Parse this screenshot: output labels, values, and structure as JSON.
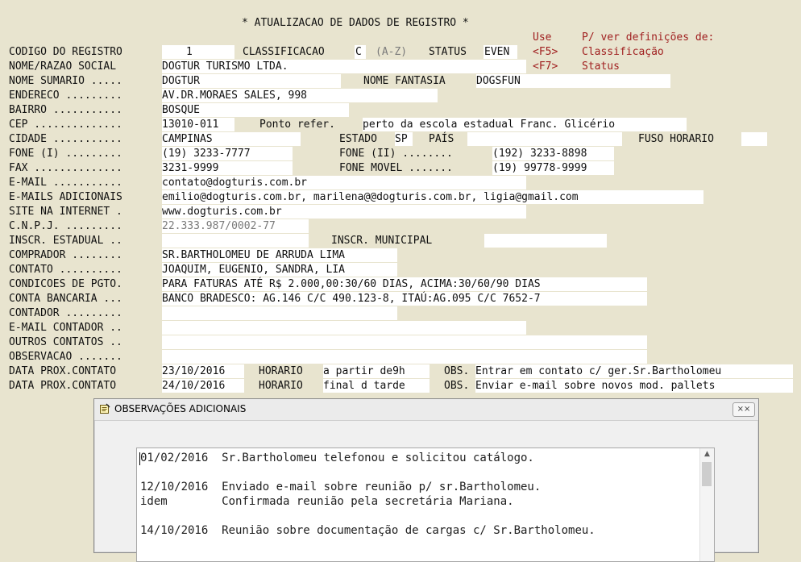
{
  "header": {
    "title": "* ATUALIZACAO DE DADOS DE REGISTRO *",
    "help_use": "Use",
    "help_pver": "P/ ver definições de:",
    "help_f5_key": "<F5>",
    "help_f5_label": "Classificação",
    "help_f7_key": "<F7>",
    "help_f7_label": "Status"
  },
  "form": {
    "codigo_label": "CODIGO DO REGISTRO",
    "codigo_value": "1",
    "classificacao_label": "CLASSIFICACAO",
    "classificacao_value": "C",
    "classificacao_hint": "(A-Z)",
    "status_label": "STATUS",
    "status_value": "EVEN",
    "nome_label": "NOME/RAZAO SOCIAL",
    "nome_value": "DOGTUR TURISMO LTDA.",
    "sumario_label": "NOME SUMARIO .....",
    "sumario_value": "DOGTUR",
    "fantasia_label": "NOME FANTASIA",
    "fantasia_value": "DOGSFUN",
    "endereco_label": "ENDERECO .........",
    "endereco_value": "AV.DR.MORAES SALES, 998",
    "bairro_label": "BAIRRO ...........",
    "bairro_value": "BOSQUE",
    "cep_label": "CEP ..............",
    "cep_value": "13010-011",
    "pref_label": "Ponto refer.",
    "pref_value": "perto da escola estadual Franc. Glicério",
    "cidade_label": "CIDADE ...........",
    "cidade_value": "CAMPINAS",
    "estado_label": "ESTADO",
    "estado_value": "SP",
    "pais_label": "PAÍS",
    "pais_value": "",
    "fuso_label": "FUSO HORARIO",
    "fuso_value": "",
    "fone1_label": "FONE (I) .........",
    "fone1_value": "(19) 3233-7777",
    "fone2_label": "FONE (II) ........",
    "fone2_value": "(192) 3233-8898",
    "fax_label": "FAX ..............",
    "fax_value": "3231-9999",
    "movel_label": "FONE MOVEL .......",
    "movel_value": "(19) 99778-9999",
    "email_label": "E-MAIL ...........",
    "email_value": "contato@dogturis.com.br",
    "emails_label": "E-MAILS ADICIONAIS",
    "emails_value": "emilio@dogturis.com.br, marilena@@dogturis.com.br, ligia@gmail.com",
    "site_label": "SITE NA INTERNET .",
    "site_value": "www.dogturis.com.br",
    "cnpj_label": "C.N.P.J. .........",
    "cnpj_value": "22.333.987/0002-77",
    "ie_label": "INSCR. ESTADUAL ..",
    "ie_value": "",
    "im_label": "INSCR. MUNICIPAL",
    "im_value": "",
    "comprador_label": "COMPRADOR ........",
    "comprador_value": "SR.BARTHOLOMEU DE ARRUDA LIMA",
    "contato_label": "CONTATO ..........",
    "contato_value": "JOAQUIM, EUGENIO, SANDRA, LIA",
    "pgto_label": "CONDICOES DE PGTO.",
    "pgto_value": "PARA FATURAS ATÉ R$ 2.000,00:30/60 DIAS, ACIMA:30/60/90 DIAS",
    "banco_label": "CONTA BANCARIA ...",
    "banco_value": "BANCO BRADESCO: AG.146 C/C 490.123-8, ITAÚ:AG.095 C/C 7652-7",
    "contador_label": "CONTADOR .........",
    "contador_value": "",
    "emailcont_label": "E-MAIL CONTADOR ..",
    "emailcont_value": "",
    "outros_label": "OUTROS CONTATOS ..",
    "outros_value": "",
    "obs_label": "OBSERVACAO .......",
    "obs_value": "",
    "dpc1_label": "DATA PROX.CONTATO",
    "dpc1_value": "23/10/2016",
    "hor1_label": "HORARIO",
    "hor1_value": "a partir de9h",
    "obs1_label": "OBS.",
    "obs1_value": "Entrar em contato c/ ger.Sr.Bartholomeu",
    "dpc2_label": "DATA PROX.CONTATO",
    "dpc2_value": "24/10/2016",
    "hor2_label": "HORARIO",
    "hor2_value": "final d tarde",
    "obs2_label": "OBS.",
    "obs2_value": "Enviar e-mail sobre novos mod. pallets"
  },
  "dialog": {
    "title": "OBSERVAÇÕES ADICIONAIS",
    "close_label": "⨯⨯",
    "lines": [
      "01/02/2016  Sr.Bartholomeu telefonou e solicitou catálogo.",
      "12/10/2016  Enviado e-mail sobre reunião p/ sr.Bartholomeu.",
      "idem        Confirmada reunião pela secretária Mariana.",
      "14/10/2016  Reunião sobre documentação de cargas c/ Sr.Bartholomeu."
    ]
  }
}
